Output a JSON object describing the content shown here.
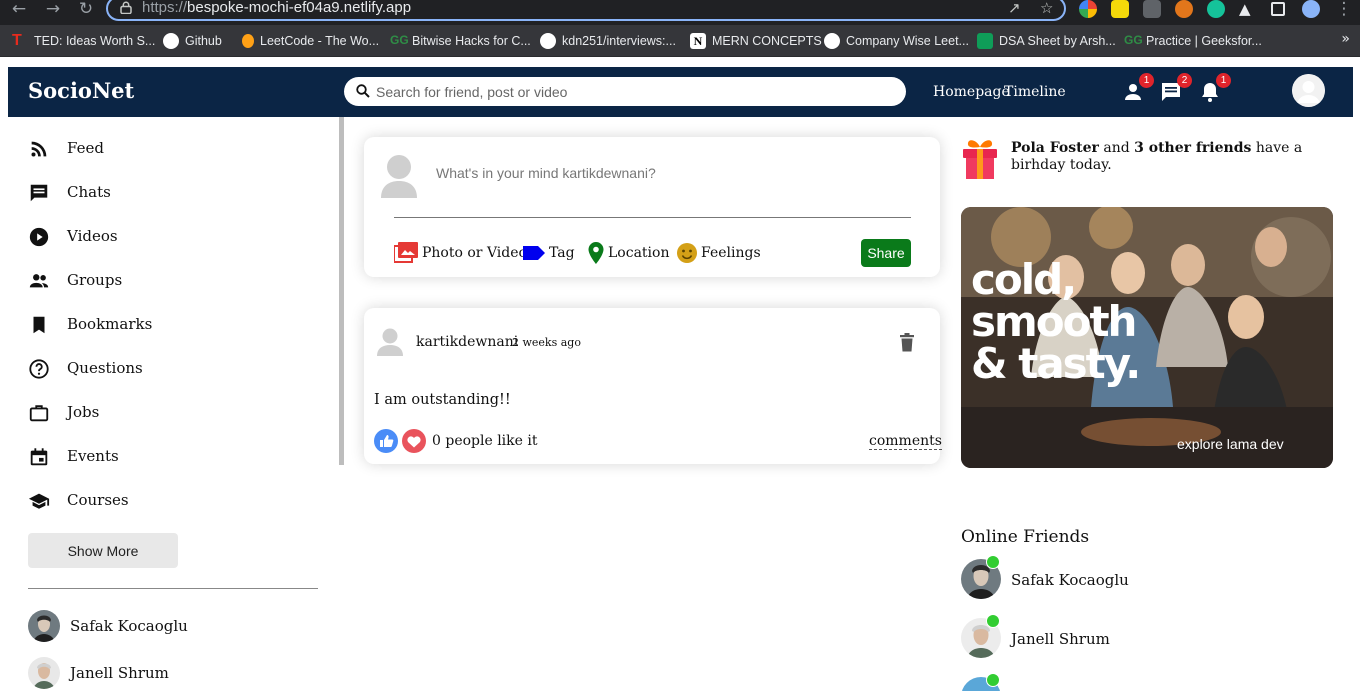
{
  "browser": {
    "url_scheme": "https://",
    "url_host": "bespoke-mochi-ef04a9.netlify.app",
    "bookmarks": [
      {
        "label": "TED: Ideas Worth S...",
        "icon": "ted-icon"
      },
      {
        "label": "Github",
        "icon": "github-icon"
      },
      {
        "label": "LeetCode - The Wo...",
        "icon": "leetcode-icon"
      },
      {
        "label": "Bitwise Hacks for C...",
        "icon": "gfg-icon"
      },
      {
        "label": "kdn251/interviews:...",
        "icon": "github-icon"
      },
      {
        "label": "MERN CONCEPTS",
        "icon": "notion-icon"
      },
      {
        "label": "Company Wise Leet...",
        "icon": "github-icon"
      },
      {
        "label": "DSA Sheet by Arsh...",
        "icon": "sheets-icon"
      },
      {
        "label": "Practice | Geeksfor...",
        "icon": "gfg-icon"
      }
    ],
    "more": "»"
  },
  "navbar": {
    "logo": "SocioNet",
    "search_placeholder": "Search for friend, post or video",
    "links": [
      "Homepage",
      "Timeline"
    ],
    "badges": {
      "friends": "1",
      "chats": "2",
      "notifications": "1"
    }
  },
  "sidebar": {
    "items": [
      {
        "label": "Feed",
        "icon": "rss-feed-icon"
      },
      {
        "label": "Chats",
        "icon": "chat-icon"
      },
      {
        "label": "Videos",
        "icon": "play-circle-icon"
      },
      {
        "label": "Groups",
        "icon": "group-icon"
      },
      {
        "label": "Bookmarks",
        "icon": "bookmark-icon"
      },
      {
        "label": "Questions",
        "icon": "help-outline-icon"
      },
      {
        "label": "Jobs",
        "icon": "work-outline-icon"
      },
      {
        "label": "Events",
        "icon": "event-icon"
      },
      {
        "label": "Courses",
        "icon": "school-icon"
      }
    ],
    "show_more": "Show More",
    "friends": [
      "Safak Kocaoglu",
      "Janell Shrum"
    ]
  },
  "share": {
    "placeholder": "What's in your mind kartikdewnani?",
    "options": [
      {
        "label": "Photo or Video",
        "icon": "perm-media-icon",
        "color": "#e53935"
      },
      {
        "label": "Tag",
        "icon": "label-icon",
        "color": "#0000ee"
      },
      {
        "label": "Location",
        "icon": "room-icon",
        "color": "#0a7a1a"
      },
      {
        "label": "Feelings",
        "icon": "emoji-emotions-icon",
        "color": "#d4a017"
      }
    ],
    "button": "Share"
  },
  "post": {
    "username": "kartikdewnani",
    "date": "2 weeks ago",
    "text": "I am outstanding!!",
    "likes": "0 people like it",
    "comments": "comments"
  },
  "rightbar": {
    "birthday_name": "Pola Foster",
    "birthday_mid": "and",
    "birthday_friends": "3 other friends",
    "birthday_end": "have a birhday today.",
    "ad_line1": "cold,",
    "ad_line2": "smooth",
    "ad_line3": "& tasty.",
    "ad_footer": "explore lama dev",
    "online_title": "Online Friends",
    "online_friends": [
      "Safak Kocaoglu",
      "Janell Shrum"
    ]
  },
  "colors": {
    "navbar": "#0b2545",
    "share_button": "#0a7a1a",
    "badge": "#e0242b",
    "online": "#32cd32",
    "like": "#4a8cf7",
    "heart": "#e9535c"
  }
}
